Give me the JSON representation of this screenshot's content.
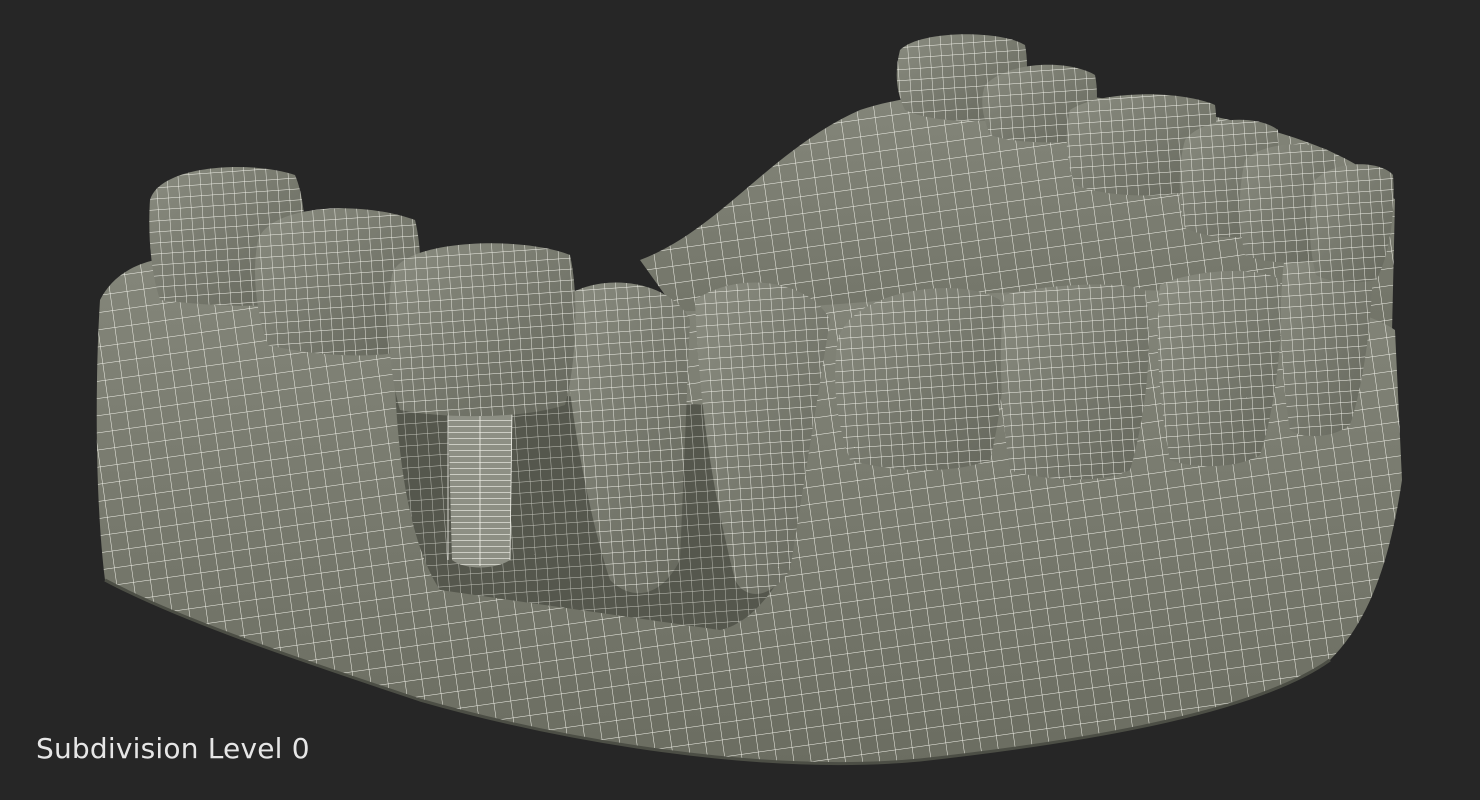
{
  "caption": "Subdivision Level 0",
  "colors": {
    "background": "#262626",
    "mesh_fill": "#7b7d6f",
    "mesh_shadow": "#5f6156",
    "wire": "#f2f2ea",
    "caption_text": "#e6e6e6"
  },
  "render": {
    "subject": "dental-jaw-model-with-implant-icon",
    "view": "wireframe-over-shaded"
  }
}
